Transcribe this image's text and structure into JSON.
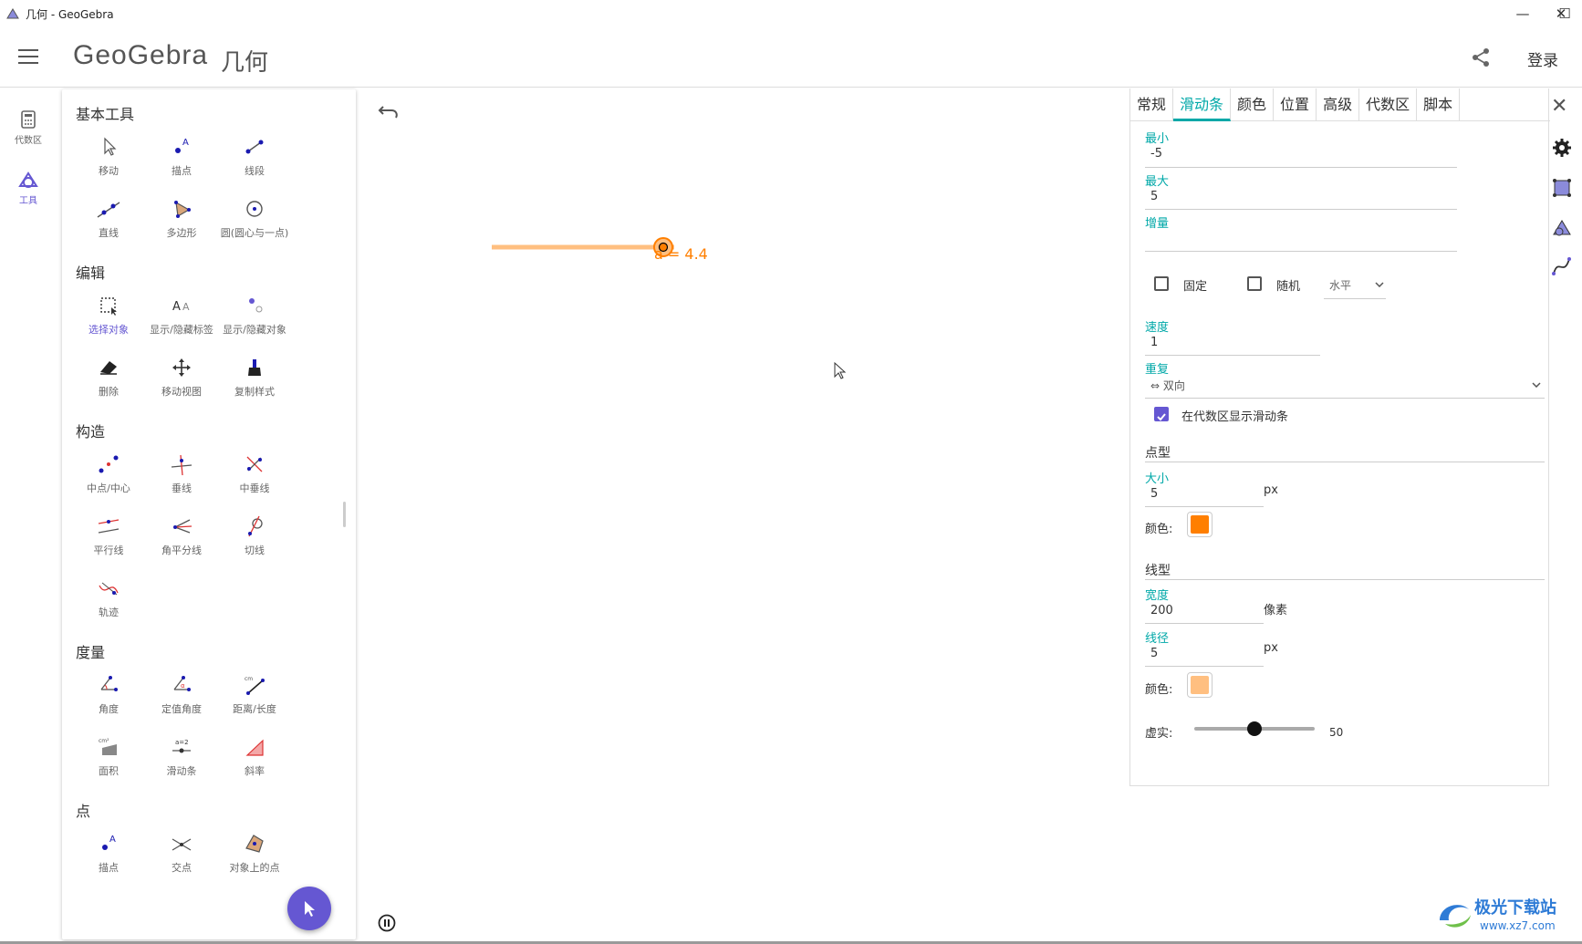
{
  "window": {
    "title": "几何 - GeoGebra",
    "minimize": "—",
    "maximize": "☐",
    "close": "✕"
  },
  "header": {
    "logo": "GeoGebra",
    "app_name": "几何",
    "login": "登录"
  },
  "rail": [
    {
      "label": "代数区",
      "icon": "calculator-icon"
    },
    {
      "label": "工具",
      "icon": "shapes-icon"
    }
  ],
  "tools": {
    "sections": {
      "basic": "基本工具",
      "edit": "编辑",
      "construct": "构造",
      "measure": "度量",
      "point": "点"
    },
    "basic": [
      "移动",
      "描点",
      "线段",
      "直线",
      "多边形",
      "圆(圆心与一点)"
    ],
    "edit": [
      "选择对象",
      "显示/隐藏标签",
      "显示/隐藏对象",
      "删除",
      "移动视图",
      "复制样式"
    ],
    "construct": [
      "中点/中心",
      "垂线",
      "中垂线",
      "平行线",
      "角平分线",
      "切线",
      "轨迹"
    ],
    "measure": [
      "角度",
      "定值角度",
      "距离/长度",
      "面积",
      "滑动条",
      "斜率"
    ],
    "point": [
      "描点",
      "交点",
      "对象上的点"
    ]
  },
  "graphics": {
    "slider_label": "a = 4.4",
    "slider_value": 4.4,
    "slider_min": -5,
    "slider_max": 5,
    "accent": "#ff7f00",
    "track_color": "#ffbf80"
  },
  "props": {
    "tabs": [
      "常规",
      "滑动条",
      "颜色",
      "位置",
      "高级",
      "代数区",
      "脚本"
    ],
    "active_tab": "滑动条",
    "min_label": "最小",
    "min_value": "-5",
    "max_label": "最大",
    "max_value": "5",
    "step_label": "增量",
    "step_value": "",
    "fixed_label": "固定",
    "random_label": "随机",
    "orientation": "水平",
    "speed_label": "速度",
    "speed_value": "1",
    "repeat_label": "重复",
    "repeat_value": "⇔ 双向",
    "show_in_algebra": "在代数区显示滑动条",
    "point_style": "点型",
    "size_label": "大小",
    "size_value": "5",
    "size_unit": "px",
    "color_label": "颜色:",
    "point_color": "#ff7f00",
    "line_style": "线型",
    "width_label": "宽度",
    "width_value": "200",
    "width_unit": "像素",
    "thickness_label": "线径",
    "thickness_value": "5",
    "thickness_unit": "px",
    "line_color": "#ffbf80",
    "opacity_label": "虚实:",
    "opacity_value": "50",
    "opacity_level": 0.5
  },
  "watermark": {
    "name": "极光下载站",
    "url": "www.xz7.com"
  }
}
